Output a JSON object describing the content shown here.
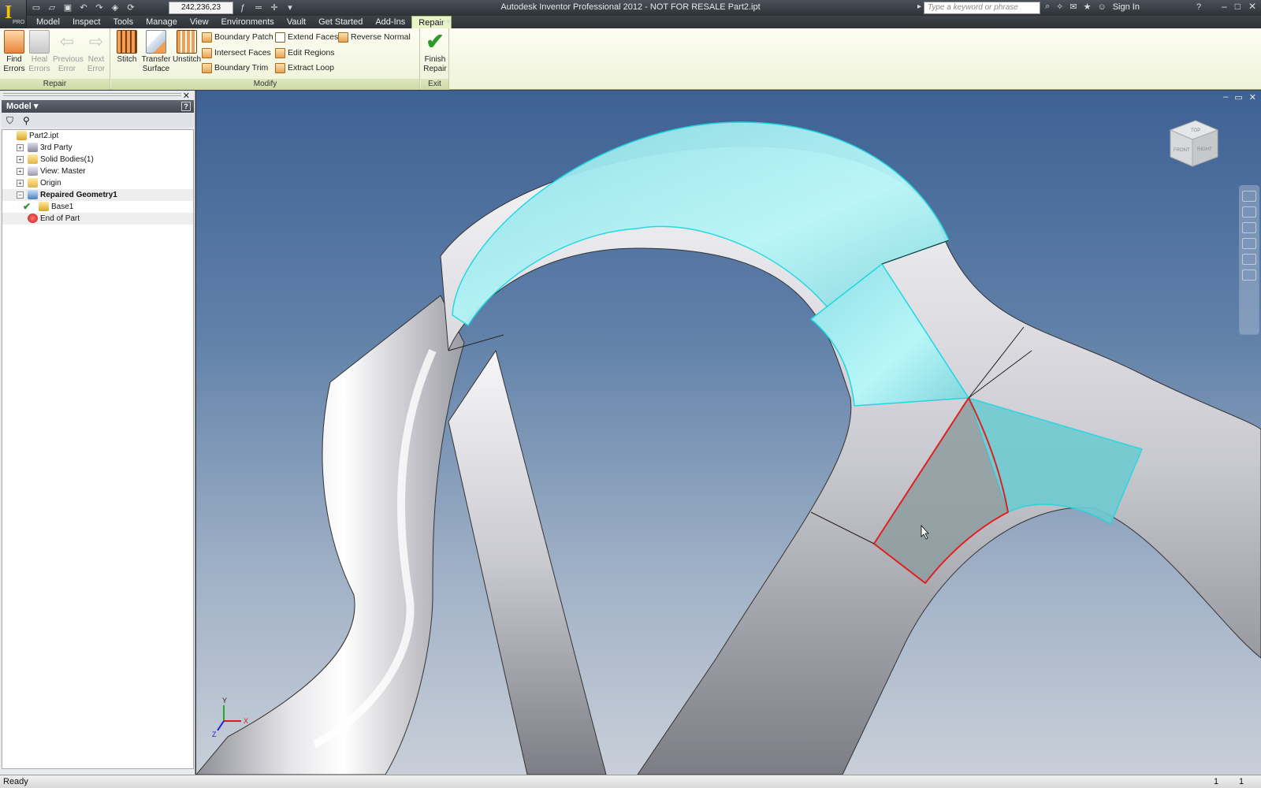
{
  "titlebar": {
    "app_title": "Autodesk Inventor Professional 2012 - NOT FOR RESALE    Part2.ipt",
    "coordinate_readout": "242,236,23",
    "search_placeholder": "Type a keyword or phrase",
    "sign_in": "Sign In",
    "pro_badge": "PRO"
  },
  "menus": [
    "Model",
    "Inspect",
    "Tools",
    "Manage",
    "View",
    "Environments",
    "Vault",
    "Get Started",
    "Add-Ins",
    "Repair"
  ],
  "active_menu": "Repair",
  "ribbon": {
    "repair_panel": {
      "label": "Repair",
      "buttons": [
        {
          "line1": "Find",
          "line2": "Errors",
          "enabled": true
        },
        {
          "line1": "Heal",
          "line2": "Errors",
          "enabled": false
        },
        {
          "line1": "Previous",
          "line2": "Error",
          "enabled": false
        },
        {
          "line1": "Next",
          "line2": "Error",
          "enabled": false
        }
      ]
    },
    "modify_panel": {
      "label": "Modify",
      "big_buttons": [
        {
          "line1": "Stitch",
          "line2": ""
        },
        {
          "line1": "Transfer",
          "line2": "Surface"
        },
        {
          "line1": "Unstitch",
          "line2": ""
        }
      ],
      "small_buttons": [
        "Boundary Patch",
        "Intersect Faces",
        "Boundary Trim",
        "Extend Faces",
        "Edit Regions",
        "Extract Loop",
        "Reverse Normal"
      ]
    },
    "exit_panel": {
      "label": "Exit",
      "button_line1": "Finish",
      "button_line2": "Repair"
    }
  },
  "browser": {
    "header": "Model",
    "tree": [
      {
        "label": "Part2.ipt",
        "icon": "part-icon",
        "indent": 0,
        "expander": "",
        "bold": false
      },
      {
        "label": "3rd Party",
        "icon": "third-party-icon",
        "indent": 1,
        "expander": "+",
        "bold": false
      },
      {
        "label": "Solid Bodies(1)",
        "icon": "folder-icon",
        "indent": 1,
        "expander": "+",
        "bold": false
      },
      {
        "label": "View: Master",
        "icon": "view-icon",
        "indent": 1,
        "expander": "+",
        "bold": false
      },
      {
        "label": "Origin",
        "icon": "folder-icon",
        "indent": 1,
        "expander": "+",
        "bold": false
      },
      {
        "label": "Repaired Geometry1",
        "icon": "repair-geometry-icon",
        "indent": 1,
        "expander": "−",
        "bold": true
      },
      {
        "label": "Base1",
        "icon": "base-body-icon",
        "indent": 2,
        "expander": "",
        "bold": false
      },
      {
        "label": "End of Part",
        "icon": "end-of-part-icon",
        "indent": 1,
        "expander": "",
        "bold": false
      }
    ]
  },
  "viewcube": {
    "left": "FRONT",
    "right": "RIGHT",
    "top": "TOP"
  },
  "triad": {
    "x": "X",
    "y": "Y",
    "z": "Z"
  },
  "status": {
    "text": "Ready",
    "count1": "1",
    "count2": "1"
  },
  "colors": {
    "highlight_cyan": "#9ef1f3",
    "error_edge_red": "#e02020",
    "ribbon_bg": "#f4f7e3",
    "viewport_top": "#3e6194",
    "viewport_bottom": "#c9cfd8"
  }
}
